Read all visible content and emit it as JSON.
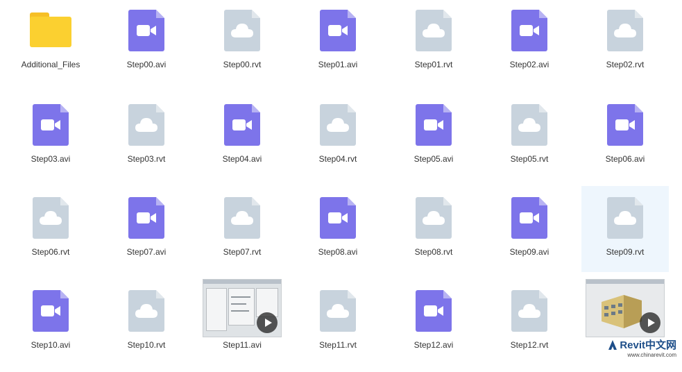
{
  "files": [
    {
      "name": "Additional_Files",
      "type": "folder",
      "icon": "folder-icon"
    },
    {
      "name": "Step00.avi",
      "type": "video",
      "icon": "video-file-icon"
    },
    {
      "name": "Step00.rvt",
      "type": "rvt",
      "icon": "cloud-file-icon"
    },
    {
      "name": "Step01.avi",
      "type": "video",
      "icon": "video-file-icon"
    },
    {
      "name": "Step01.rvt",
      "type": "rvt",
      "icon": "cloud-file-icon"
    },
    {
      "name": "Step02.avi",
      "type": "video",
      "icon": "video-file-icon"
    },
    {
      "name": "Step02.rvt",
      "type": "rvt",
      "icon": "cloud-file-icon"
    },
    {
      "name": "Step03.avi",
      "type": "video",
      "icon": "video-file-icon"
    },
    {
      "name": "Step03.rvt",
      "type": "rvt",
      "icon": "cloud-file-icon"
    },
    {
      "name": "Step04.avi",
      "type": "video",
      "icon": "video-file-icon"
    },
    {
      "name": "Step04.rvt",
      "type": "rvt",
      "icon": "cloud-file-icon"
    },
    {
      "name": "Step05.avi",
      "type": "video",
      "icon": "video-file-icon"
    },
    {
      "name": "Step05.rvt",
      "type": "rvt",
      "icon": "cloud-file-icon"
    },
    {
      "name": "Step06.avi",
      "type": "video",
      "icon": "video-file-icon"
    },
    {
      "name": "Step06.rvt",
      "type": "rvt",
      "icon": "cloud-file-icon"
    },
    {
      "name": "Step07.avi",
      "type": "video",
      "icon": "video-file-icon"
    },
    {
      "name": "Step07.rvt",
      "type": "rvt",
      "icon": "cloud-file-icon"
    },
    {
      "name": "Step08.avi",
      "type": "video",
      "icon": "video-file-icon"
    },
    {
      "name": "Step08.rvt",
      "type": "rvt",
      "icon": "cloud-file-icon"
    },
    {
      "name": "Step09.avi",
      "type": "video",
      "icon": "video-file-icon"
    },
    {
      "name": "Step09.rvt",
      "type": "rvt",
      "icon": "cloud-file-icon",
      "selected": true
    },
    {
      "name": "Step10.avi",
      "type": "video",
      "icon": "video-file-icon"
    },
    {
      "name": "Step10.rvt",
      "type": "rvt",
      "icon": "cloud-file-icon"
    },
    {
      "name": "Step11.avi",
      "type": "thumb-plan",
      "icon": "video-thumbnail"
    },
    {
      "name": "Step11.rvt",
      "type": "rvt",
      "icon": "cloud-file-icon"
    },
    {
      "name": "Step12.avi",
      "type": "video",
      "icon": "video-file-icon"
    },
    {
      "name": "Step12.rvt",
      "type": "rvt",
      "icon": "cloud-file-icon"
    },
    {
      "name": "",
      "type": "thumb-building",
      "icon": "video-thumbnail"
    }
  ],
  "watermark": {
    "brand": "Revit中文网",
    "url": "www.chinarevit.com"
  },
  "colors": {
    "video_icon": "#7d74ea",
    "rvt_icon": "#c8d3dd",
    "folder": "#fbd030",
    "selection": "#eef6fd"
  }
}
